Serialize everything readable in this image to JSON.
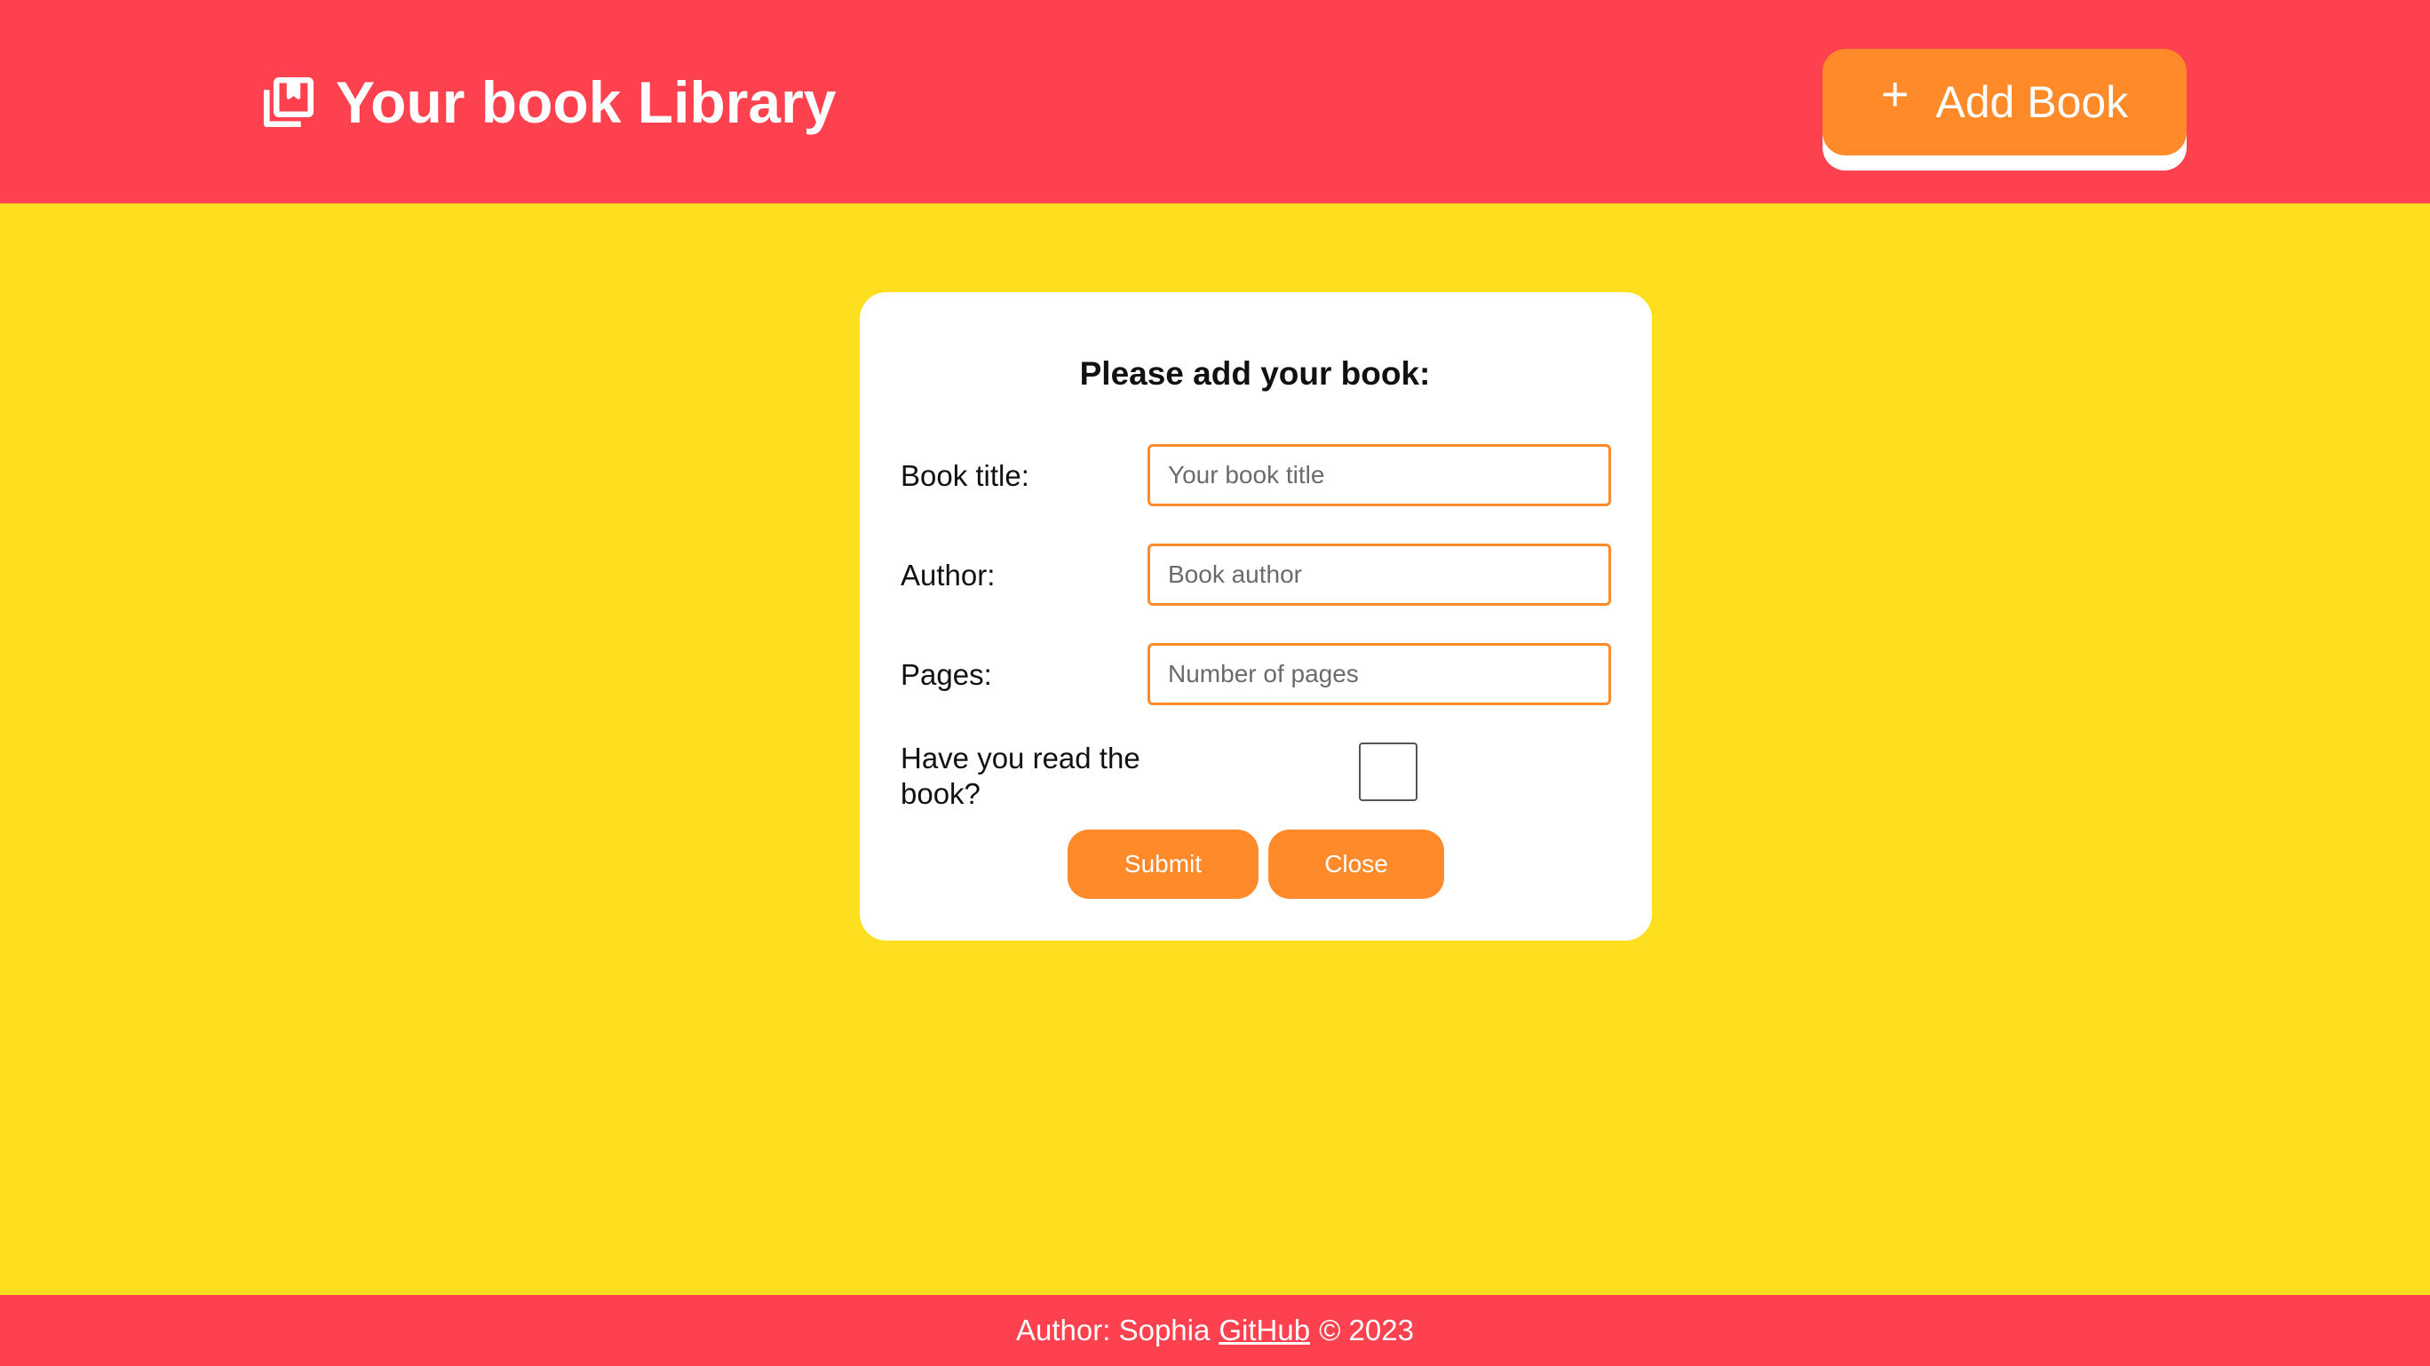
{
  "colors": {
    "header_bg": "#fe414e",
    "page_bg": "#fedf20",
    "accent": "#fe8a2a",
    "card_bg": "#ffffff"
  },
  "header": {
    "logo_icon": "library-books-icon",
    "title": "Your book Library",
    "add_button": {
      "icon": "plus-icon",
      "label": "Add Book"
    }
  },
  "modal": {
    "title": "Please add your book:",
    "fields": {
      "title": {
        "label": "Book title:",
        "placeholder": "Your book title",
        "value": ""
      },
      "author": {
        "label": "Author:",
        "placeholder": "Book author",
        "value": ""
      },
      "pages": {
        "label": "Pages:",
        "placeholder": "Number of pages",
        "value": ""
      },
      "read": {
        "label": "Have you read the book?",
        "checked": false
      }
    },
    "submit_label": "Submit",
    "close_label": "Close"
  },
  "footer": {
    "prefix": "Author: Sophia",
    "link_label": "GitHub",
    "suffix": "© 2023"
  }
}
